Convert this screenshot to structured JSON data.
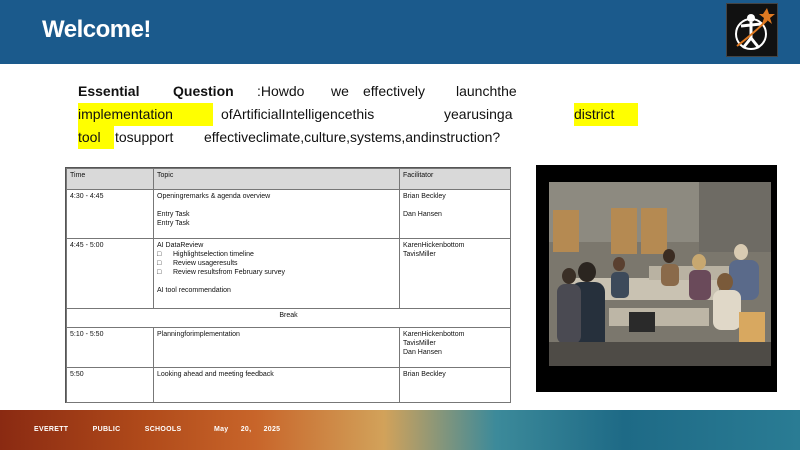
{
  "header": {
    "title": "Welcome!"
  },
  "question": {
    "lines": [
      [
        "Essential",
        "Question",
        ":Howdo",
        "we",
        "effectively",
        "launchthe"
      ],
      [
        "implementation",
        "ofArtificialIntelligencethis",
        "yearusinga",
        "district"
      ],
      [
        "tool",
        "tosupport",
        "effectiveclimate,culture,systems,andinstruction?"
      ]
    ]
  },
  "agenda": {
    "headers": {
      "time": "Time",
      "topic": "Topic",
      "facilitator": "Facilitator"
    },
    "rows": [
      {
        "time": "4:30 - 4:45",
        "topic": [
          "Openingremarks & agenda overview",
          "",
          "Entry Task",
          "Entry Task"
        ],
        "facilitator": [
          "Brian Beckley",
          "",
          "Dan Hansen"
        ]
      },
      {
        "time": "4:45 - 5:00",
        "topic": [
          "AI DataReview",
          "Highlightselection timeline",
          "Review usageresults",
          "Review resultsfrom February survey",
          "",
          "AI tool recommendation"
        ],
        "facilitator": [
          "KarenHickenbottom",
          "TavisMiller"
        ]
      },
      {
        "break": "Break"
      },
      {
        "time": "5:10 - 5:50",
        "topic": [
          "Planningforimplementation"
        ],
        "facilitator": [
          "KarenHickenbottom",
          "TavisMiller",
          "Dan Hansen"
        ]
      },
      {
        "time": "5:50",
        "topic": [
          "Looking ahead and meeting feedback"
        ],
        "facilitator": [
          "Brian Beckley"
        ]
      }
    ],
    "bullet": "□"
  },
  "footer": {
    "org": "EVERETT PUBLIC SCHOOLS",
    "date": "May 20, 2025"
  }
}
